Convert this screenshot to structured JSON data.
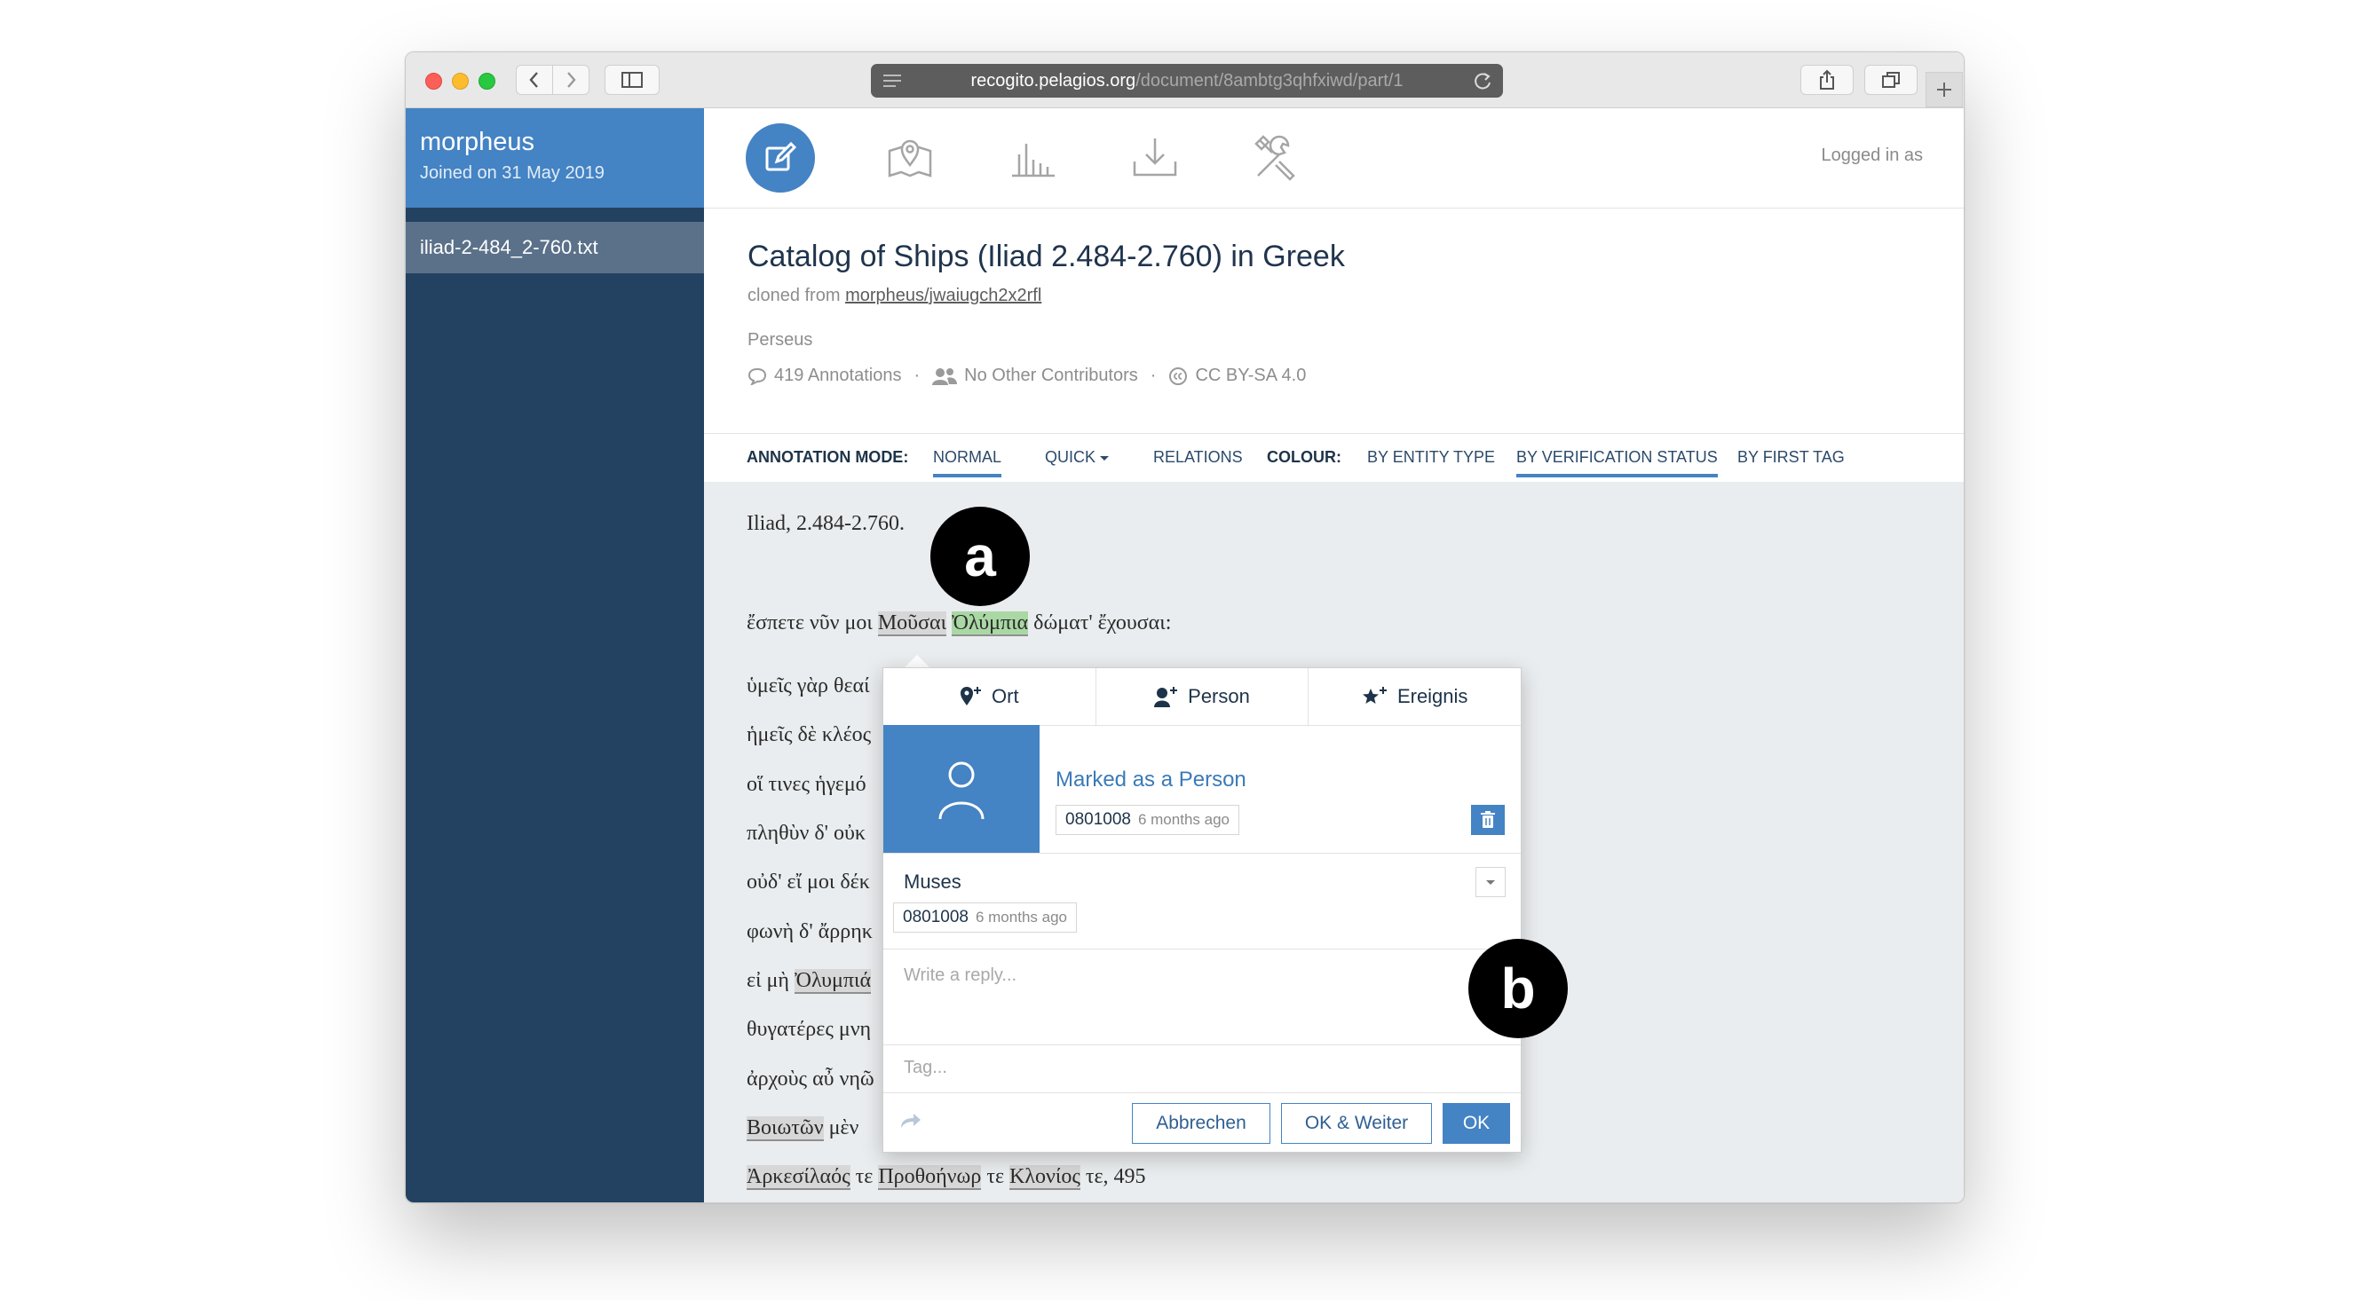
{
  "browser": {
    "url_host": "recogito.pelagios.org",
    "url_path": "/document/8ambtg3qhfxiwd/part/1"
  },
  "sidebar": {
    "username": "morpheus",
    "joined": "Joined on 31 May 2019",
    "document_file": "iliad-2-484_2-760.txt"
  },
  "header": {
    "nav_icons": [
      "edit-icon",
      "map-icon",
      "stats-icon",
      "download-icon",
      "settings-icon"
    ],
    "logged_in": "Logged in as"
  },
  "document": {
    "title": "Catalog of Ships (Iliad 2.484-2.760) in Greek",
    "cloned_prefix": "cloned from",
    "cloned_link": "morpheus/jwaiugch2x2rfl",
    "source": "Perseus",
    "annotations": "419 Annotations",
    "contributors": "No Other Contributors",
    "license": "CC BY-SA 4.0"
  },
  "toolbar": {
    "annotation_mode_label": "ANNOTATION MODE:",
    "normal": "NORMAL",
    "quick": "QUICK",
    "relations": "RELATIONS",
    "colour_label": "COLOUR:",
    "by_entity": "BY ENTITY TYPE",
    "by_verification": "BY VERIFICATION STATUS",
    "by_tag": "BY FIRST TAG"
  },
  "text": {
    "heading": "Iliad, 2.484-2.760.",
    "line1_pre": "ἔσπετε νῦν μοι",
    "line1_w1": "Μοῦσαι",
    "line1_w2": "Ὀλύμπια",
    "line1_post": "δώματ' ἔχουσαι:",
    "l2": "ὑμεῖς γὰρ θεαί",
    "l3": "ἡμεῖς δὲ κλέος",
    "l4": "οἵ τινες ἡγεμό",
    "l5": "πληθὺν δ' οὐκ",
    "l6": "οὐδ' εἴ μοι δέκ",
    "l7": "φωνὴ δ' ἄρρηκ",
    "l8_pre": "εἰ μὴ",
    "l8_w": "Ὀλυμπιά",
    "l9": "θυγατέρες μνη",
    "l10": "ἀρχοὺς αὖ νηῶ",
    "l11_w": "Βοιωτῶν",
    "l11_post": "μὲν",
    "l12_w1": "Ἀρκεσίλαός",
    "l12_t1": "τε",
    "l12_w2": "Προθοήνωρ",
    "l12_t2": "τε",
    "l12_w3": "Κλονίος",
    "l12_post": "τε, 495"
  },
  "popup": {
    "tabs": [
      "Ort",
      "Person",
      "Ereignis"
    ],
    "marked": "Marked as a Person",
    "user_id": "0801008",
    "time_ago": "6 months ago",
    "entity": "Muses",
    "reply_placeholder": "Write a reply...",
    "tag_placeholder": "Tag...",
    "cancel": "Abbrechen",
    "ok_next": "OK & Weiter",
    "ok": "OK"
  },
  "markers": {
    "a": "a",
    "b": "b"
  },
  "colors": {
    "brand_blue": "#4483c4",
    "sidebar": "#234160",
    "annotation_green": "#a9d8a4",
    "annotation_grey": "#d7d7d7"
  }
}
